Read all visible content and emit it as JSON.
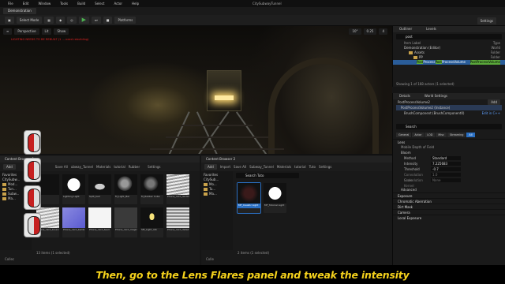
{
  "menubar": {
    "items": [
      "File",
      "Edit",
      "Window",
      "Tools",
      "Build",
      "Select",
      "Actor",
      "Help"
    ],
    "project_title": "CitySubwayTunnel"
  },
  "tabs": {
    "level_tab": "Demonstration"
  },
  "toolbar": {
    "select_mode": "Select Mode",
    "platforms": "Platforms",
    "settings": "Settings"
  },
  "viewport": {
    "perspective": "Perspective",
    "lit": "Lit",
    "show": "Show",
    "warning": "LIGHTING NEEDS TO BE REBUILT (1 ... need rebuilding)",
    "right_values": [
      "10°",
      "0.25",
      "4"
    ]
  },
  "content_browser_1": {
    "tab": "Content Browser 1",
    "add": "Add",
    "save_all": "Save All",
    "crumbs": [
      "ubway_Tunnel",
      "Materials",
      "tutorial",
      "Rubber"
    ],
    "settings": "Settings",
    "favorites": "Favorites",
    "root": "CitySubw...",
    "tree_items": [
      "Mod...",
      "Tun...",
      "Subw...",
      "Ma..."
    ],
    "assets": [
      "",
      "Lighting Light",
      "Split_ball",
      "M_Light_Bal",
      "M_Rubber Cube",
      "Phone_card_landmark",
      "Phone_card_bounce",
      "Phone_card_bamb",
      "Phone_card_tearl",
      "Phone_card_magicnear",
      "SM_Light_Alb",
      "Phone_card_detail"
    ],
    "footer": "13 items (1 selected)",
    "collections": "Collec"
  },
  "content_browser_2": {
    "tab": "Content Browser 2",
    "add": "Add",
    "import": "Import",
    "save_all": "Save All",
    "crumbs": [
      "Subway_Tunnel",
      "Materials",
      "tutorial",
      "Tuto"
    ],
    "settings": "Settings",
    "search_placeholder": "Search Tuto",
    "favorites": "Favorites",
    "root": "CitySub...",
    "tree_items": [
      "Mo...",
      "Tu...",
      "Ma..."
    ],
    "assets": [
      "MF_Caustic Light",
      "MF_Tutorial Light"
    ],
    "footer": "2 items (1 selected)",
    "collections": "Colle"
  },
  "outliner": {
    "tab": "Outliner",
    "levels_tab": "Levels",
    "search_value": "post",
    "col_label": "Item Label",
    "col_type": "Type",
    "rows": [
      {
        "label": "Demonstration (Editor)",
        "type": "World"
      },
      {
        "label": "Assets",
        "type": "Folder"
      },
      {
        "label": "PP",
        "type": "Folder"
      },
      {
        "label_pre": "",
        "label_hl": "Post",
        "label_mid": "Process",
        "label_hl2": "Post",
        "label_post": "ProcessVolume",
        "type": "PostProcessVolume"
      }
    ],
    "footer": "Showing 1 of 168 actors (1 selected)"
  },
  "details": {
    "tab": "Details",
    "world_settings": "World Settings",
    "actor_name": "PostProcessVolume2",
    "add": "Add",
    "instance": "PostProcessVolume2 (Instance)",
    "component": "BrushComponent (BrushComponent0)",
    "edit_cpp": "Edit in C++",
    "search_placeholder": "Search",
    "filters": [
      "General",
      "Actor",
      "LOD",
      "Misc",
      "Streaming",
      "All"
    ],
    "lens_label": "Lens",
    "mobile_dof": "Mobile Depth of Field",
    "bloom_label": "Bloom",
    "props": [
      {
        "name": "Method",
        "value": "Standard"
      },
      {
        "name": "Intensity",
        "value": "7.225683"
      },
      {
        "name": "Threshold",
        "value": "-0.7"
      },
      {
        "name": "Convolution Scale",
        "value": "1.0"
      },
      {
        "name": "Convolution Kernel",
        "value": "None"
      }
    ],
    "advanced": "Advanced",
    "categories": [
      "Exposure",
      "Chromatic Aberration",
      "Dirt Mask",
      "Camera",
      "Local Exposure"
    ]
  },
  "subtitle": "Then, go to the Lens Flares panel and tweak the intensity",
  "colors": {
    "accent": "#2a6fc2",
    "subtitle": "#f5d21c",
    "highlight": "#5aa83a"
  }
}
